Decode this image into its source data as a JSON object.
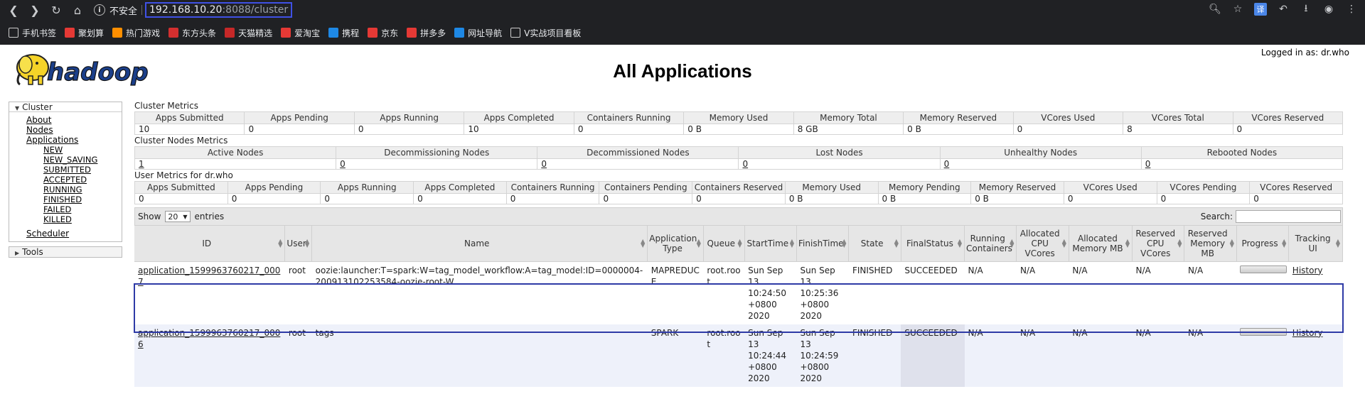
{
  "browser": {
    "secure_label": "不安全",
    "url_host": "192.168.10.20",
    "url_rest": ":8088/cluster",
    "translate_label": "译",
    "bookmarks": [
      {
        "label": "手机书签",
        "color": "#ffffff"
      },
      {
        "label": "聚划算",
        "color": "#e53935"
      },
      {
        "label": "热门游戏",
        "color": "#ff8f00"
      },
      {
        "label": "东方头条",
        "color": "#d32f2f"
      },
      {
        "label": "天猫精选",
        "color": "#c62828"
      },
      {
        "label": "爱淘宝",
        "color": "#e53935"
      },
      {
        "label": "携程",
        "color": "#1e88e5"
      },
      {
        "label": "京东",
        "color": "#e53935"
      },
      {
        "label": "拼多多",
        "color": "#e53935"
      },
      {
        "label": "网址导航",
        "color": "#1e88e5"
      },
      {
        "label": "V实战项目看板",
        "color": "#ffffff"
      }
    ]
  },
  "page": {
    "title": "All Applications",
    "login": "Logged in as: dr.who",
    "logo_text": "hadoop"
  },
  "sidebar": {
    "cluster_label": "Cluster",
    "links": [
      "About",
      "Nodes",
      "Applications"
    ],
    "states": [
      "NEW",
      "NEW_SAVING",
      "SUBMITTED",
      "ACCEPTED",
      "RUNNING",
      "FINISHED",
      "FAILED",
      "KILLED"
    ],
    "scheduler": "Scheduler",
    "tools_label": "Tools"
  },
  "cluster_metrics": {
    "title": "Cluster Metrics",
    "headers": [
      "Apps Submitted",
      "Apps Pending",
      "Apps Running",
      "Apps Completed",
      "Containers Running",
      "Memory Used",
      "Memory Total",
      "Memory Reserved",
      "VCores Used",
      "VCores Total",
      "VCores Reserved"
    ],
    "values": [
      "10",
      "0",
      "0",
      "10",
      "0",
      "0 B",
      "8 GB",
      "0 B",
      "0",
      "8",
      "0"
    ]
  },
  "node_metrics": {
    "title": "Cluster Nodes Metrics",
    "headers": [
      "Active Nodes",
      "Decommissioning Nodes",
      "Decommissioned Nodes",
      "Lost Nodes",
      "Unhealthy Nodes",
      "Rebooted Nodes"
    ],
    "values": [
      "1",
      "0",
      "0",
      "0",
      "0",
      "0"
    ]
  },
  "user_metrics": {
    "title": "User Metrics for dr.who",
    "headers": [
      "Apps Submitted",
      "Apps Pending",
      "Apps Running",
      "Apps Completed",
      "Containers Running",
      "Containers Pending",
      "Containers Reserved",
      "Memory Used",
      "Memory Pending",
      "Memory Reserved",
      "VCores Used",
      "VCores Pending",
      "VCores Reserved"
    ],
    "values": [
      "0",
      "0",
      "0",
      "0",
      "0",
      "0",
      "0",
      "0 B",
      "0 B",
      "0 B",
      "0",
      "0",
      "0"
    ]
  },
  "apps": {
    "show_label": "Show",
    "show_value": "20",
    "entries_label": "entries",
    "search_label": "Search:",
    "headers": [
      "ID",
      "User",
      "Name",
      "Application Type",
      "Queue",
      "StartTime",
      "FinishTime",
      "State",
      "FinalStatus",
      "Running Containers",
      "Allocated CPU VCores",
      "Allocated Memory MB",
      "Reserved CPU VCores",
      "Reserved Memory MB",
      "Progress",
      "Tracking UI"
    ],
    "rows": [
      {
        "id": "application_1599963760217_0007",
        "user": "root",
        "name": "oozie:launcher:T=spark:W=tag_model_workflow:A=tag_model:ID=0000004-200913102253584-oozie-root-W",
        "type": "MAPREDUCE",
        "queue": "root.root",
        "start": "Sun Sep 13 10:24:50 +0800 2020",
        "finish": "Sun Sep 13 10:25:36 +0800 2020",
        "state": "FINISHED",
        "final_status": "SUCCEEDED",
        "running_containers": "N/A",
        "alloc_cpu": "N/A",
        "alloc_mem": "N/A",
        "res_cpu": "N/A",
        "res_mem": "N/A",
        "progress": 1,
        "tracking": "History"
      },
      {
        "id": "application_1599963760217_0006",
        "user": "root",
        "name": "tags",
        "type": "SPARK",
        "queue": "root.root",
        "start": "Sun Sep 13 10:24:44 +0800 2020",
        "finish": "Sun Sep 13 10:24:59 +0800 2020",
        "state": "FINISHED",
        "final_status": "SUCCEEDED",
        "running_containers": "N/A",
        "alloc_cpu": "N/A",
        "alloc_mem": "N/A",
        "res_cpu": "N/A",
        "res_mem": "N/A",
        "progress": 1,
        "tracking": "History"
      }
    ]
  }
}
